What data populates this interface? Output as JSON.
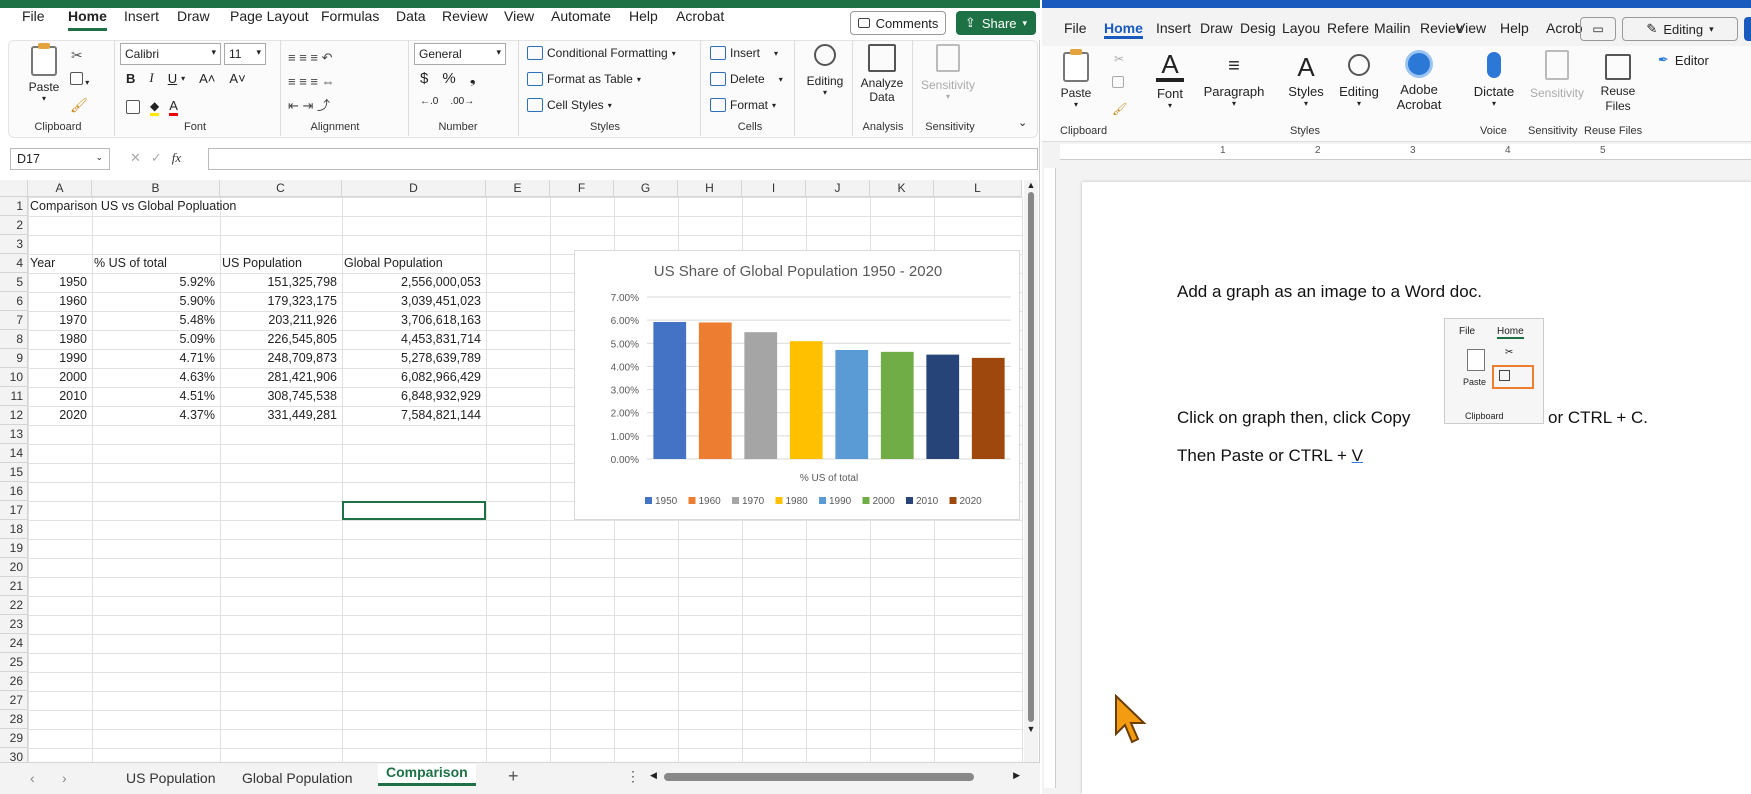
{
  "excel": {
    "menu": [
      "File",
      "Home",
      "Insert",
      "Draw",
      "Page Layout",
      "Formulas",
      "Data",
      "Review",
      "View",
      "Automate",
      "Help",
      "Acrobat"
    ],
    "active_tab": "Home",
    "comments_label": "Comments",
    "share_label": "Share",
    "ribbon": {
      "paste": "Paste",
      "font_name": "Calibri",
      "font_size": "11",
      "number_format": "General",
      "conditional_formatting": "Conditional Formatting",
      "format_as_table": "Format as Table",
      "cell_styles": "Cell Styles",
      "insert": "Insert",
      "delete": "Delete",
      "format": "Format",
      "editing": "Editing",
      "analyze_data": "Analyze Data",
      "sensitivity": "Sensitivity",
      "groups": [
        "Clipboard",
        "Font",
        "Alignment",
        "Number",
        "Styles",
        "Cells",
        "Analysis",
        "Sensitivity"
      ]
    },
    "name_box": "D17",
    "fx": "fx",
    "columns": [
      "A",
      "B",
      "C",
      "D",
      "E",
      "F",
      "G",
      "H",
      "I",
      "J",
      "K",
      "L"
    ],
    "rows": [
      "1",
      "2",
      "3",
      "4",
      "5",
      "6",
      "7",
      "8",
      "9",
      "10",
      "11",
      "12",
      "13",
      "14",
      "15",
      "16",
      "17",
      "18",
      "19",
      "20",
      "21",
      "22",
      "23",
      "24",
      "25",
      "26",
      "27",
      "28",
      "29",
      "30"
    ],
    "title_cell": "Comparison US vs Global Popluation",
    "headers": [
      "Year",
      "% US of total",
      "US Population",
      "Global Population"
    ],
    "data": [
      [
        "1950",
        "5.92%",
        "151,325,798",
        "2,556,000,053"
      ],
      [
        "1960",
        "5.90%",
        "179,323,175",
        "3,039,451,023"
      ],
      [
        "1970",
        "5.48%",
        "203,211,926",
        "3,706,618,163"
      ],
      [
        "1980",
        "5.09%",
        "226,545,805",
        "4,453,831,714"
      ],
      [
        "1990",
        "4.71%",
        "248,709,873",
        "5,278,639,789"
      ],
      [
        "2000",
        "4.63%",
        "281,421,906",
        "6,082,966,429"
      ],
      [
        "2010",
        "4.51%",
        "308,745,538",
        "6,848,932,929"
      ],
      [
        "2020",
        "4.37%",
        "331,449,281",
        "7,584,821,144"
      ]
    ],
    "sheet_tabs": [
      "US Population",
      "Global Population",
      "Comparison"
    ],
    "active_sheet": "Comparison"
  },
  "chart_data": {
    "type": "bar",
    "title": "US Share of Global Population 1950 - 2020",
    "xlabel": "% US of total",
    "ylabel": "",
    "categories": [
      "1950",
      "1960",
      "1970",
      "1980",
      "1990",
      "2000",
      "2010",
      "2020"
    ],
    "values": [
      5.92,
      5.9,
      5.48,
      5.09,
      4.71,
      4.63,
      4.51,
      4.37
    ],
    "ylim": [
      0,
      7
    ],
    "yticks": [
      "0.00%",
      "1.00%",
      "2.00%",
      "3.00%",
      "4.00%",
      "5.00%",
      "6.00%",
      "7.00%"
    ],
    "colors": [
      "#4472C4",
      "#ED7D31",
      "#A5A5A5",
      "#FFC000",
      "#5B9BD5",
      "#70AD47",
      "#264478",
      "#9E480E"
    ],
    "legend": "bottom",
    "grid": true
  },
  "word": {
    "menu": [
      "File",
      "Home",
      "Insert",
      "Draw",
      "Desig",
      "Layou",
      "Refere",
      "Mailin",
      "Reviev",
      "View",
      "Help",
      "Acrob"
    ],
    "active_tab": "Home",
    "editing_mode": "Editing",
    "ribbon": {
      "paste": "Paste",
      "font": "Font",
      "paragraph": "Paragraph",
      "styles": "Styles",
      "editing": "Editing",
      "adobe_acrobat": "Adobe Acrobat",
      "dictate": "Dictate",
      "sensitivity": "Sensitivity",
      "reuse_files": "Reuse Files",
      "editor": "Editor",
      "groups": [
        "Clipboard",
        "Styles",
        "Voice",
        "Sensitivity",
        "Reuse Files"
      ]
    },
    "ruler": [
      "1",
      "2",
      "3",
      "4",
      "5"
    ],
    "doc_line1": "Add a graph as an image to a Word doc.",
    "doc_line2a": "Click on graph then, click Copy",
    "doc_line2b": "or CTRL + C.",
    "doc_line3a": "Then Paste or CTRL + ",
    "doc_line3b": "V",
    "inset": {
      "file": "File",
      "home": "Home",
      "paste": "Paste",
      "clipboard": "Clipboard"
    }
  }
}
